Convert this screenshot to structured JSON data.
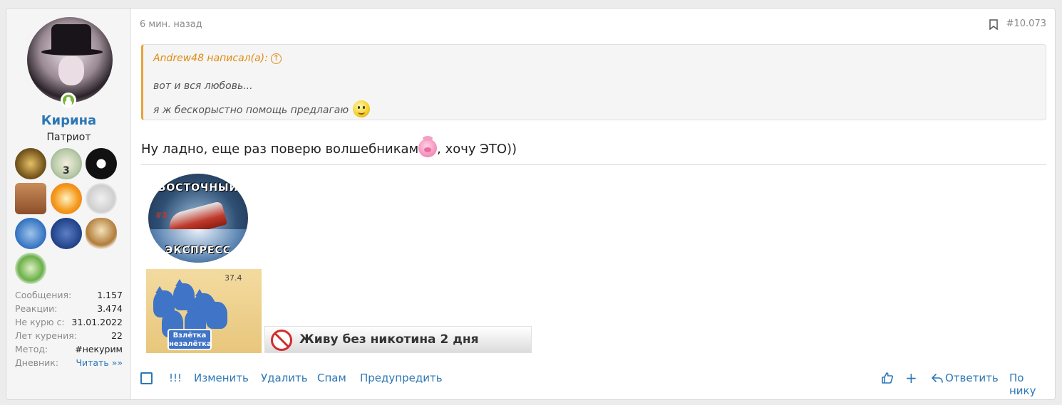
{
  "user": {
    "name": "Кирина",
    "title": "Патриот",
    "awards": [
      "trophy-award",
      "planes-award-3",
      "dark-figure-award",
      "suitcase-award",
      "book-award",
      "megaphone-award",
      "flex-award",
      "team-award",
      "owl-award",
      "camera-award"
    ],
    "award_badge_count": "3",
    "stats": [
      {
        "label": "Сообщения:",
        "value": "1.157"
      },
      {
        "label": "Реакции:",
        "value": "3.474"
      },
      {
        "label": "Не курю с:",
        "value": "31.01.2022"
      },
      {
        "label": "Лет курения:",
        "value": "22"
      },
      {
        "label": "Метод:",
        "value": "#некурим"
      },
      {
        "label": "Дневник:",
        "value": "Читать »»"
      }
    ]
  },
  "post": {
    "time": "6 мин. назад",
    "number": "#10.073",
    "quote": {
      "author": "Andrew48 написал(а):",
      "line1": "вот и вся любовь...",
      "line2": "я ж бескорыстно помощь предлагаю"
    },
    "text_before": "Ну ладно, еще раз поверю волшебникам",
    "text_after": ", хочу ЭТО))"
  },
  "signature": {
    "badge_top": "ВОСТОЧНЫЙ",
    "badge_bottom": "ЭКСПРЕСС",
    "badge_number": "#3",
    "cats_number": "37.4",
    "cats_label_line1": "Взлётка",
    "cats_label_line2": "незалётка",
    "banner_text": "Живу без никотина 2 дня"
  },
  "actions": {
    "exclaim": "!!!",
    "edit": "Изменить",
    "delete": "Удалить",
    "spam": "Спам",
    "warn": "Предупредить",
    "reply": "Ответить",
    "by_nick": "По нику"
  },
  "colors": {
    "link": "#2d77b5",
    "quote_accent": "#e8a23a",
    "online": "#7bb33b"
  }
}
